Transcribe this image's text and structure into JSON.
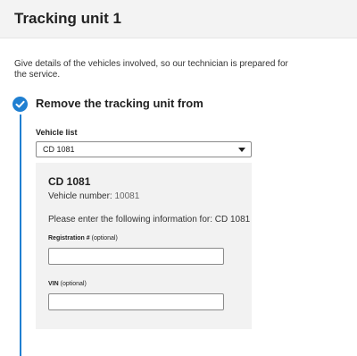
{
  "header": {
    "title": "Tracking unit 1"
  },
  "intro": "Give details of the vehicles involved, so our technician is prepared for the service.",
  "step": {
    "icon": "check-circle-icon",
    "title": "Remove the tracking unit from",
    "accent_color": "#1f7fd1"
  },
  "vehicle_list": {
    "label": "Vehicle list",
    "selected": "CD 1081"
  },
  "vehicle": {
    "name": "CD 1081",
    "number_label": "Vehicle number:",
    "number_value": "10081",
    "instruction": "Please enter the following information for: CD 1081"
  },
  "registration": {
    "label": "Registration #",
    "optional": "(optional)",
    "value": ""
  },
  "vin": {
    "label": "VIN",
    "optional": "(optional)",
    "value": ""
  }
}
